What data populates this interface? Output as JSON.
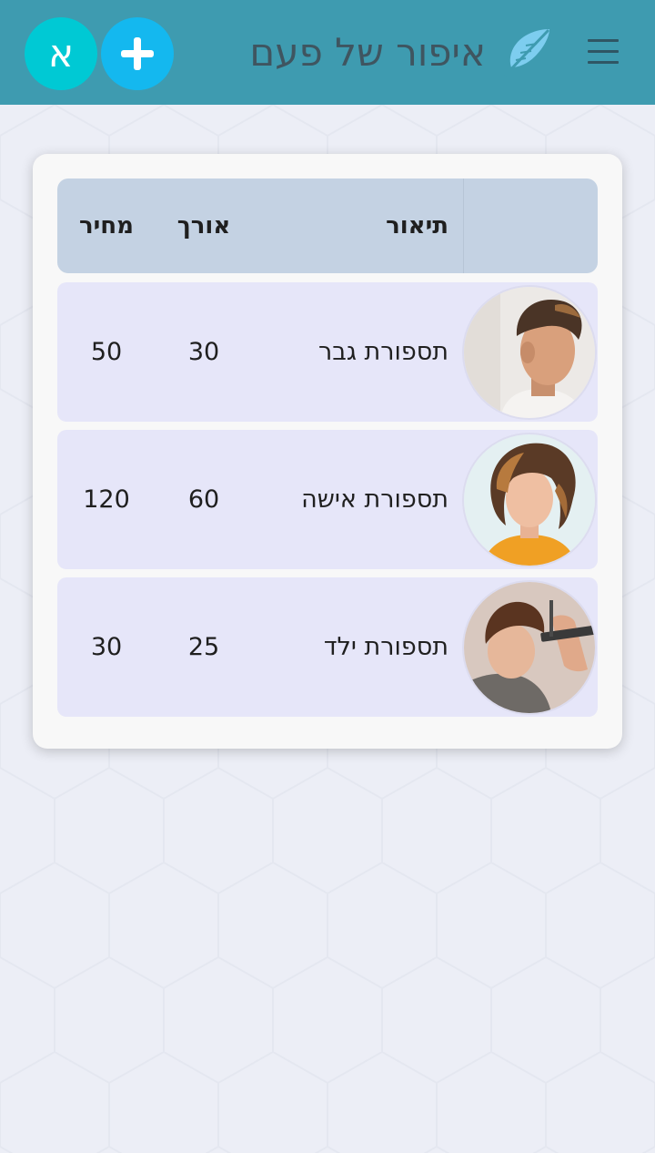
{
  "header": {
    "app_title": "איפור של פעם",
    "language_button_label": "א",
    "add_button_icon": "plus-icon",
    "menu_icon": "hamburger-menu-icon",
    "logo_icon": "feather-icon"
  },
  "table": {
    "columns": {
      "description": "תיאור",
      "length": "אורך",
      "price": "מחיר"
    },
    "rows": [
      {
        "image": "man-haircut-photo",
        "description": "תספורת גבר",
        "length": "30",
        "price": "50"
      },
      {
        "image": "woman-haircut-photo",
        "description": "תספורת אישה",
        "length": "60",
        "price": "120"
      },
      {
        "image": "child-haircut-photo",
        "description": "תספורת ילד",
        "length": "25",
        "price": "30"
      }
    ]
  },
  "colors": {
    "header_bg": "#3e9bb0",
    "title_text": "#3f5560",
    "language_button_bg": "#00c9d4",
    "add_button_bg": "#14b8ef",
    "table_header_bg": "#c4d2e3",
    "row_bg": "#e6e6f9",
    "page_bg": "#eceef6"
  }
}
